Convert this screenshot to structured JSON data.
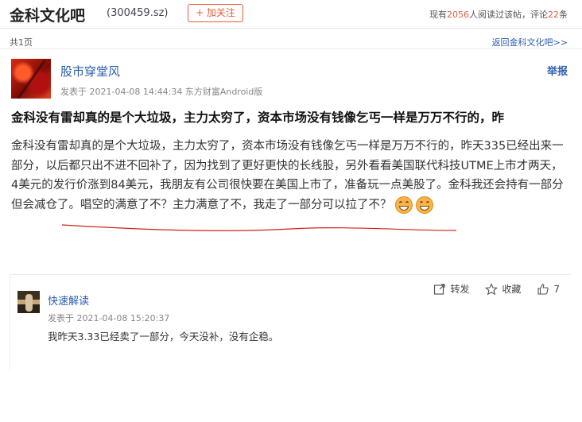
{
  "header": {
    "bar_title": "金科文化吧",
    "bar_code": "(300459.sz)",
    "follow_label": "+ 加关注",
    "stats_prefix": "现有",
    "readers": "2056",
    "stats_middle": "人阅读过该帖，评论",
    "comments": "22",
    "stats_suffix": "条"
  },
  "subbar": {
    "page_count": "共1页",
    "back_link": "返回金科文化吧>>"
  },
  "post": {
    "author": "股市穿堂风",
    "meta": "发表于 2021-04-08 14:44:34 东方财富Android版",
    "report_label": "举报",
    "title": "金科没有雷却真的是个大垃圾，主力太穷了，资本市场没有钱像乞丐一样是万万不行的，昨",
    "body": "金科没有雷却真的是个大垃圾，主力太穷了，资本市场没有钱像乞丐一样是万万不行的，昨天335已经出来一部分，以后都只出不进不回补了，因为找到了更好更快的长线股，另外看看美国联代科技UTME上市才两天，4美元的发行价涨到84美元，我朋友有公司很快要在美国上市了，准备玩一点美股了。金科我还会持有一部分但会减仓了。唱空的满意了不？主力满意了不，我走了一部分可以拉了不？"
  },
  "actions": {
    "share_label": "转发",
    "collect_label": "收藏",
    "like_count": "7"
  },
  "reply": {
    "author": "快速解读",
    "meta": "发表于 2021-04-08 15:20:37",
    "text": "我昨天3.33已经卖了一部分，今天没补，没有企稳。"
  },
  "colors": {
    "accent": "#e85c3c",
    "link": "#2a5db0"
  }
}
